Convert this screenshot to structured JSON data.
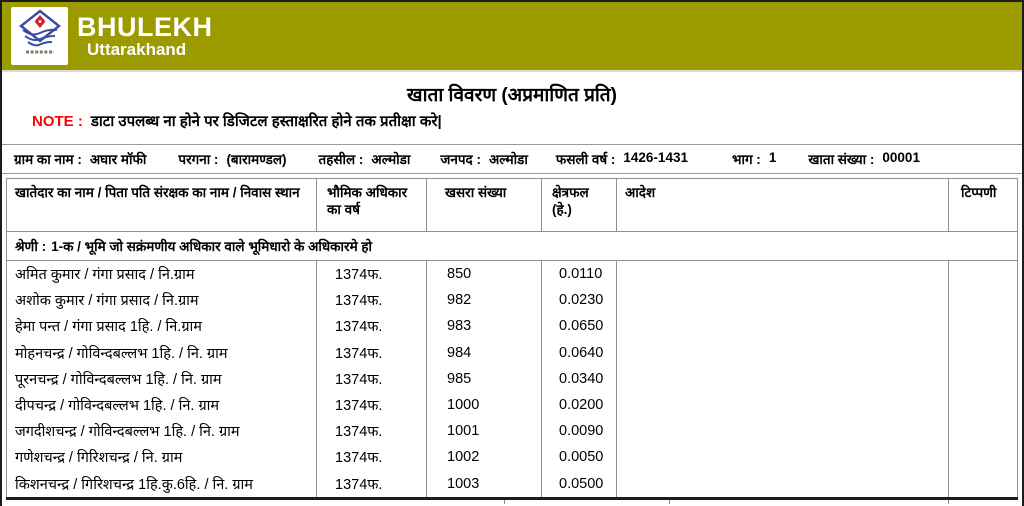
{
  "header": {
    "brand": "BHULEKH",
    "brand_sub": "Uttarakhand",
    "logo_icon": "uttarakhand-emblem",
    "bg_color": "#9B9B00"
  },
  "page": {
    "title": "खाता विवरण (अप्रमाणित प्रति)",
    "note_label": "NOTE :",
    "note_text": "डाटा उपलब्ध ना होने पर डिजिटल हस्ताक्षरित होने तक प्रतीक्षा करे|",
    "note_color": "#FF0000"
  },
  "info": {
    "items": [
      {
        "label": "ग्राम का नाम :",
        "value": "अघार मॉफी"
      },
      {
        "label": "परगना :",
        "value": "(बारामण्डल)"
      },
      {
        "label": "तहसील :",
        "value": "अल्मोडा"
      },
      {
        "label": "जनपद :",
        "value": "अल्मोडा"
      },
      {
        "label": "फसली वर्ष :",
        "value": "1426-1431"
      },
      {
        "label": "भाग :",
        "value": "1"
      },
      {
        "label": "खाता संख्या :",
        "value": "00001"
      }
    ]
  },
  "table": {
    "columns": [
      "खातेदार का नाम / पिता पति संरक्षक का नाम / निवास स्थान",
      "भौमिक अधिकार का वर्ष",
      "खसरा संख्या",
      "क्षेत्रफल (हे.)",
      "आदेश",
      "टिप्पणी"
    ],
    "category_label": "श्रेणी :",
    "category_text": "1-क / भूमि जो सक्रंमणीय अधिकार वाले भूमिधारो के अधिकारमे हो",
    "rows": [
      {
        "name": "अमित कुमार / गंगा प्रसाद / नि.ग्राम",
        "year": "1374फ.",
        "khasra": "850",
        "area": "0.0110",
        "order": "",
        "remark": ""
      },
      {
        "name": "अशोक कुमार / गंगा प्रसाद / नि.ग्राम",
        "year": "1374फ.",
        "khasra": "982",
        "area": "0.0230",
        "order": "",
        "remark": ""
      },
      {
        "name": "हेमा पन्त / गंगा प्रसाद 1हि. / नि.ग्राम",
        "year": "1374फ.",
        "khasra": "983",
        "area": "0.0650",
        "order": "",
        "remark": ""
      },
      {
        "name": "मोहनचन्द्र / गोविन्दबल्लभ 1हि. / नि. ग्राम",
        "year": "1374फ.",
        "khasra": "984",
        "area": "0.0640",
        "order": "",
        "remark": ""
      },
      {
        "name": "पूरनचन्द्र / गोविन्दबल्लभ 1हि. / नि. ग्राम",
        "year": "1374फ.",
        "khasra": "985",
        "area": "0.0340",
        "order": "",
        "remark": ""
      },
      {
        "name": "दीपचन्द्र / गोविन्दबल्लभ 1हि. / नि. ग्राम",
        "year": "1374फ.",
        "khasra": "1000",
        "area": "0.0200",
        "order": "",
        "remark": ""
      },
      {
        "name": "जगदीशचन्द्र / गोविन्दबल्लभ 1हि. / नि. ग्राम",
        "year": "1374फ.",
        "khasra": "1001",
        "area": "0.0090",
        "order": "",
        "remark": ""
      },
      {
        "name": "गणेशचन्द्र / गिरिशचन्द्र / नि. ग्राम",
        "year": "1374फ.",
        "khasra": "1002",
        "area": "0.0050",
        "order": "",
        "remark": ""
      },
      {
        "name": "किशनचन्द्र / गिरिशचन्द्र 1हि.कु.6हि. / नि. ग्राम",
        "year": "1374फ.",
        "khasra": "1003",
        "area": "0.0500",
        "order": "",
        "remark": ""
      }
    ]
  }
}
